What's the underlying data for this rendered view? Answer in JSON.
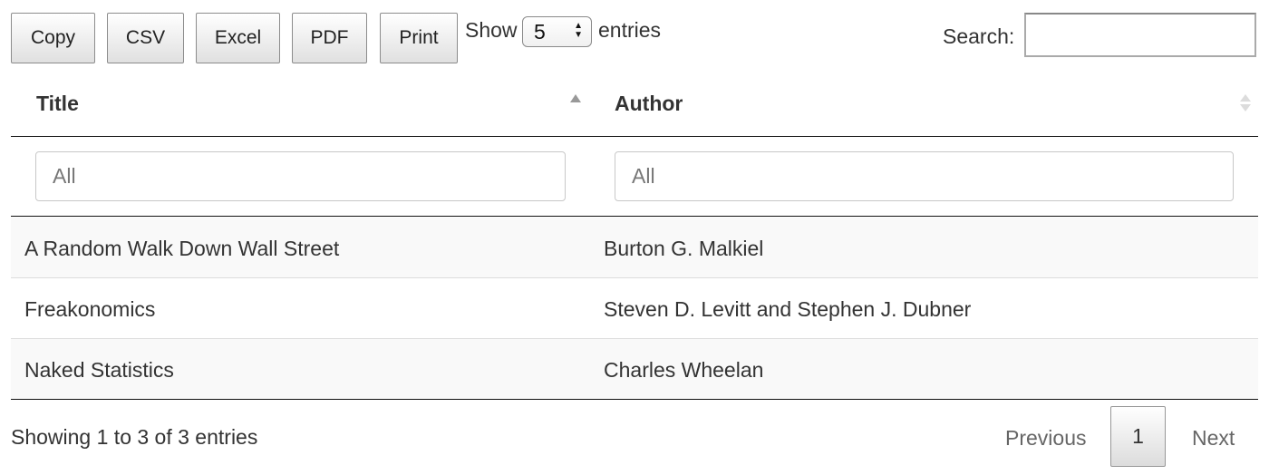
{
  "toolbar": {
    "buttons": [
      "Copy",
      "CSV",
      "Excel",
      "PDF",
      "Print"
    ]
  },
  "length": {
    "prefix": "Show",
    "value": "5",
    "suffix": "entries"
  },
  "search": {
    "label": "Search:",
    "value": ""
  },
  "table": {
    "columns": [
      "Title",
      "Author"
    ],
    "filters": [
      {
        "placeholder": "All"
      },
      {
        "placeholder": "All"
      }
    ],
    "rows": [
      [
        "A Random Walk Down Wall Street",
        "Burton G. Malkiel"
      ],
      [
        "Freakonomics",
        "Steven D. Levitt and Stephen J. Dubner"
      ],
      [
        "Naked Statistics",
        "Charles Wheelan"
      ]
    ]
  },
  "footer": {
    "info": "Showing 1 to 3 of 3 entries",
    "pagination": {
      "previous": "Previous",
      "current": "1",
      "next": "Next"
    }
  },
  "colors": {
    "header_border": "#111111",
    "row_stripe": "#f9f9f9",
    "row_border": "#dddddd"
  }
}
